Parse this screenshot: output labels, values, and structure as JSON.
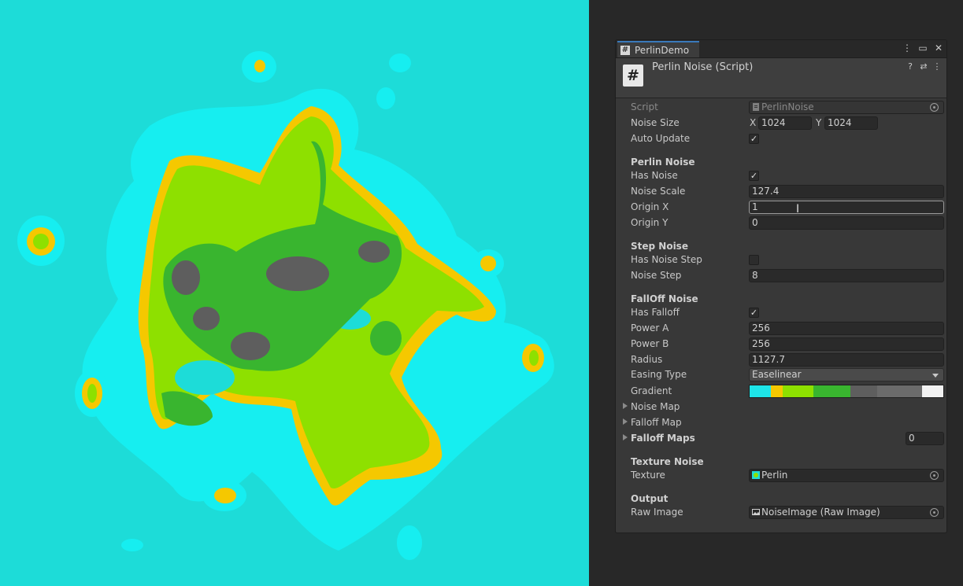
{
  "tab": {
    "title": "PerlinDemo"
  },
  "window_icons": [
    "kebab-menu-icon",
    "maximize-icon",
    "close-icon"
  ],
  "component": {
    "title": "Perlin Noise (Script)",
    "icons": [
      "help-icon",
      "preset-icon",
      "kebab-menu-icon"
    ]
  },
  "fields": {
    "script": {
      "label": "Script",
      "value": "PerlinNoise"
    },
    "noise_size": {
      "label": "Noise Size",
      "x_label": "X",
      "x": "1024",
      "y_label": "Y",
      "y": "1024"
    },
    "auto_update": {
      "label": "Auto Update",
      "checked": true
    }
  },
  "perlin": {
    "header": "Perlin Noise",
    "has_noise": {
      "label": "Has Noise",
      "checked": true
    },
    "noise_scale": {
      "label": "Noise Scale",
      "value": "127.4"
    },
    "origin_x": {
      "label": "Origin X",
      "value": "1"
    },
    "origin_y": {
      "label": "Origin Y",
      "value": "0"
    }
  },
  "step": {
    "header": "Step Noise",
    "has_noise_step": {
      "label": "Has Noise Step",
      "checked": false
    },
    "noise_step": {
      "label": "Noise Step",
      "value": "8"
    }
  },
  "falloff": {
    "header": "FallOff Noise",
    "has_falloff": {
      "label": "Has Falloff",
      "checked": true
    },
    "power_a": {
      "label": "Power A",
      "value": "256"
    },
    "power_b": {
      "label": "Power B",
      "value": "256"
    },
    "radius": {
      "label": "Radius",
      "value": "1127.7"
    },
    "easing_type": {
      "label": "Easing Type",
      "value": "Easelinear"
    },
    "gradient": {
      "label": "Gradient",
      "stops": [
        {
          "color": "#1ee5e8",
          "fraction": 0.11
        },
        {
          "color": "#f5c800",
          "fraction": 0.06
        },
        {
          "color": "#8ee000",
          "fraction": 0.16
        },
        {
          "color": "#39b52f",
          "fraction": 0.19
        },
        {
          "color": "#5e5e5e",
          "fraction": 0.14
        },
        {
          "color": "#6b6b6b",
          "fraction": 0.23
        },
        {
          "color": "#f2f2f2",
          "fraction": 0.11
        }
      ]
    },
    "noise_map": {
      "label": "Noise Map"
    },
    "falloff_map": {
      "label": "Falloff Map"
    },
    "falloff_maps": {
      "label": "Falloff Maps",
      "value": "0"
    }
  },
  "texture": {
    "header": "Texture Noise",
    "texture": {
      "label": "Texture",
      "value": "Perlin"
    }
  },
  "output": {
    "header": "Output",
    "raw_image": {
      "label": "Raw Image",
      "value": "NoiseImage (Raw Image)"
    }
  },
  "colors": {
    "water": "#1ddcd8",
    "shallow": "#16eef0",
    "sand": "#f5c800",
    "grass": "#8ee000",
    "forest": "#39b52f",
    "rock": "#5e5e5e",
    "editor_bg": "#282828"
  }
}
